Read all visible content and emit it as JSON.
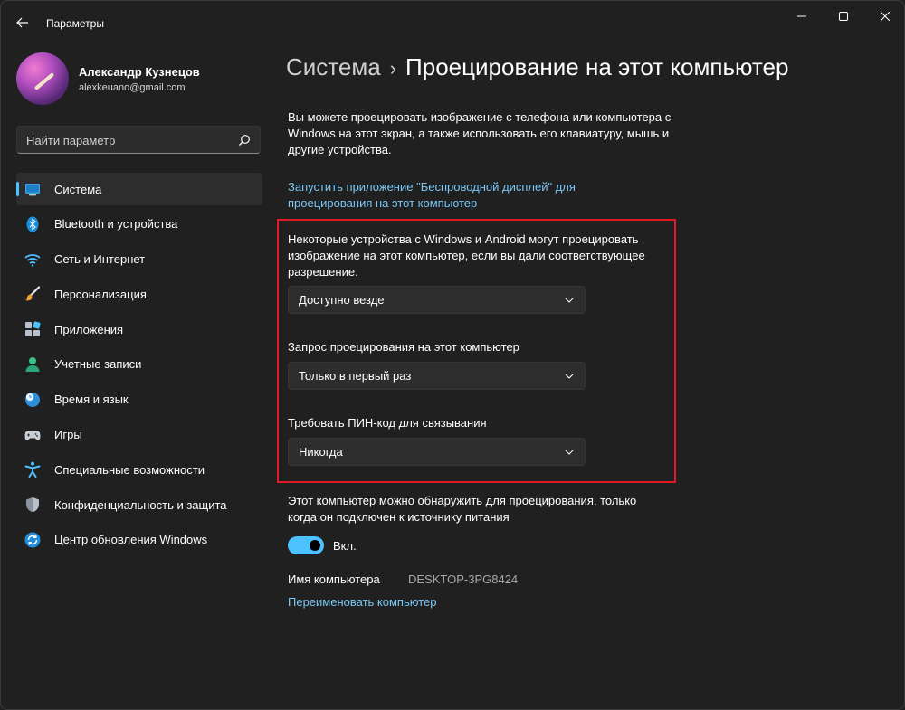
{
  "window": {
    "title": "Параметры"
  },
  "profile": {
    "name": "Александр Кузнецов",
    "email": "alexkeuano@gmail.com"
  },
  "search": {
    "placeholder": "Найти параметр"
  },
  "sidebar": {
    "items": [
      {
        "label": "Система",
        "icon": "system-icon",
        "active": true
      },
      {
        "label": "Bluetooth и устройства",
        "icon": "bluetooth-icon"
      },
      {
        "label": "Сеть и Интернет",
        "icon": "wifi-icon"
      },
      {
        "label": "Персонализация",
        "icon": "brush-icon"
      },
      {
        "label": "Приложения",
        "icon": "apps-icon"
      },
      {
        "label": "Учетные записи",
        "icon": "account-icon"
      },
      {
        "label": "Время и язык",
        "icon": "clock-globe-icon"
      },
      {
        "label": "Игры",
        "icon": "gamepad-icon"
      },
      {
        "label": "Специальные возможности",
        "icon": "accessibility-icon"
      },
      {
        "label": "Конфиденциальность и защита",
        "icon": "shield-icon"
      },
      {
        "label": "Центр обновления Windows",
        "icon": "update-icon"
      }
    ]
  },
  "breadcrumb": {
    "parent": "Система",
    "separator": "›",
    "current": "Проецирование на этот компьютер"
  },
  "main": {
    "description": "Вы можете проецировать изображение с телефона или компьютера с Windows на этот экран, а также использовать его клавиатуру, мышь и другие устройства.",
    "launch_link": "Запустить приложение \"Беспроводной дисплей\" для проецирования на этот компьютер",
    "setting1": {
      "label": "Некоторые устройства с Windows и Android могут проецировать изображение на этот компьютер, если вы дали соответствующее разрешение.",
      "value": "Доступно везде"
    },
    "setting2": {
      "label": "Запрос проецирования на этот компьютер",
      "value": "Только в первый раз"
    },
    "setting3": {
      "label": "Требовать ПИН-код для связывания",
      "value": "Никогда"
    },
    "power_text": "Этот компьютер можно обнаружить для проецирования, только когда он подключен к источнику питания",
    "toggle": {
      "label": "Вкл.",
      "on": true
    },
    "pc_name_label": "Имя компьютера",
    "pc_name_value": "DESKTOP-3PG8424",
    "rename_link": "Переименовать компьютер"
  },
  "colors": {
    "accent": "#4cc2ff",
    "highlight": "#e01b24",
    "link": "#7cc7f5",
    "background": "#202020"
  }
}
